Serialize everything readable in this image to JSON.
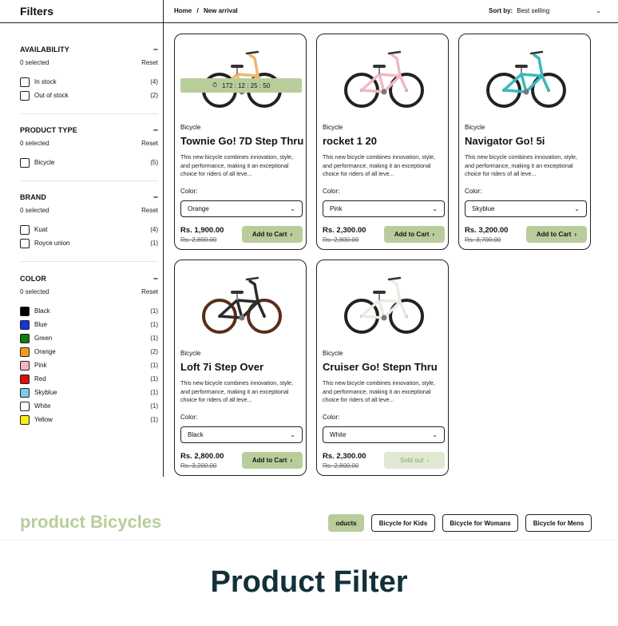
{
  "sidebar": {
    "title": "Filters",
    "groups": [
      {
        "name": "AVAILABILITY",
        "toggle": "–",
        "selected": "0 selected",
        "reset": "Reset",
        "items": [
          {
            "label": "In stock",
            "count": "(4)"
          },
          {
            "label": "Out of stock",
            "count": "(2)"
          }
        ]
      },
      {
        "name": "PRODUCT TYPE",
        "toggle": "–",
        "selected": "0 selected",
        "reset": "Reset",
        "items": [
          {
            "label": "Bicycle",
            "count": "(5)"
          }
        ]
      },
      {
        "name": "BRAND",
        "toggle": "–",
        "selected": "0 selected",
        "reset": "Reset",
        "items": [
          {
            "label": "Kuat",
            "count": "(4)"
          },
          {
            "label": "Royce union",
            "count": "(1)"
          }
        ]
      },
      {
        "name": "COLOR",
        "toggle": "–",
        "selected": "0 selected",
        "reset": "Reset",
        "items": [
          {
            "label": "Black",
            "count": "(1)",
            "swatch": "#000000"
          },
          {
            "label": "Blue",
            "count": "(1)",
            "swatch": "#1533e0"
          },
          {
            "label": "Green",
            "count": "(1)",
            "swatch": "#0d7a12"
          },
          {
            "label": "Orange",
            "count": "(2)",
            "swatch": "#f59a1b"
          },
          {
            "label": "Pink",
            "count": "(1)",
            "swatch": "#f4b7c2"
          },
          {
            "label": "Red",
            "count": "(1)",
            "swatch": "#e40b0b"
          },
          {
            "label": "Skyblue",
            "count": "(1)",
            "swatch": "#7ec8ea"
          },
          {
            "label": "White",
            "count": "(1)",
            "swatch": "#ffffff"
          },
          {
            "label": "Yellow",
            "count": "(1)",
            "swatch": "#f7ef12"
          }
        ]
      }
    ]
  },
  "header": {
    "breadcrumb": [
      "Home",
      "/",
      "New arrival"
    ],
    "sort_label": "Sort by:",
    "sort_value": "Best selling"
  },
  "products": [
    {
      "category": "Bicycle",
      "name": "Townie Go! 7D Step Thru",
      "desc": "This new bicycle combines innovation, style, and performance, making it an exceptional choice for riders of all leve...",
      "color_label": "Color:",
      "color": "Orange",
      "price": "Rs. 1,900.00",
      "old_price": "Rs. 2,800.00",
      "button": "Add to Cart",
      "timer": "172 : 12 : 25 : 50",
      "frame_color": "#f0b76a"
    },
    {
      "category": "Bicycle",
      "name": "rocket 1 20",
      "desc": "This new bicycle combines innovation, style, and performance, making it an exceptional choice for riders of all leve...",
      "color_label": "Color:",
      "color": "Pink",
      "price": "Rs. 2,300.00",
      "old_price": "Rs. 2,800.00",
      "button": "Add to Cart",
      "frame_color": "#f2b8c4"
    },
    {
      "category": "Bicycle",
      "name": "Navigator Go! 5i",
      "desc": "This new bicycle combines innovation, style, and performance, making it an exceptional choice for riders of all leve...",
      "color_label": "Color:",
      "color": "Skyblue",
      "price": "Rs. 3,200.00",
      "old_price": "Rs. 3,700.00",
      "button": "Add to Cart",
      "frame_color": "#3bb9b9"
    },
    {
      "category": "Bicycle",
      "name": "Loft 7i Step Over",
      "desc": "This new bicycle combines innovation, style, and performance, making it an exceptional choice for riders of all leve...",
      "color_label": "Color:",
      "color": "Black",
      "price": "Rs. 2,800.00",
      "old_price": "Rs. 3,200.00",
      "button": "Add to Cart",
      "frame_color": "#2b2b2b"
    },
    {
      "category": "Bicycle",
      "name": "Cruiser Go! Stepn Thru",
      "desc": "This new bicycle combines innovation, style, and performance, making it an exceptional choice for riders of all leve...",
      "color_label": "Color:",
      "color": "White",
      "price": "Rs. 2,300.00",
      "old_price": "Rs. 2,800.00",
      "button": "Sold out",
      "frame_color": "#e6ece3"
    }
  ],
  "bottom": {
    "title": "product Bicycles",
    "tabs": [
      "oducts",
      "Bicycle for Kids",
      "Bicycle for Womans",
      "Bicycle for Mens"
    ]
  },
  "caption": "Product Filter",
  "colors": {
    "accent": "#b9cd9b",
    "caption": "#13303a"
  }
}
